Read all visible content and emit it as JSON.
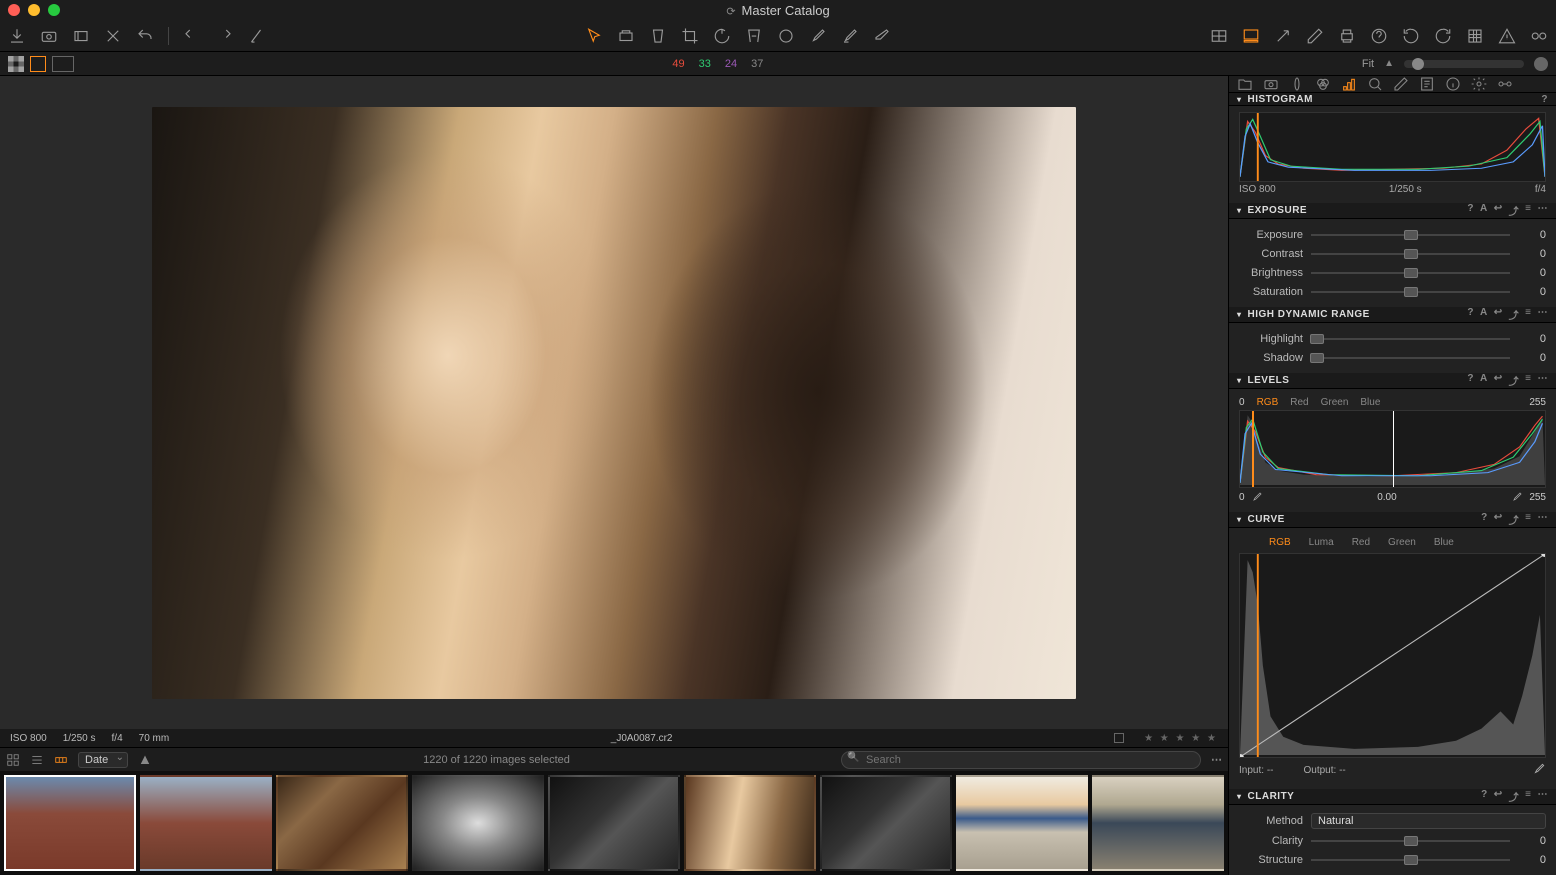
{
  "window": {
    "title": "Master Catalog"
  },
  "counts": {
    "red": "49",
    "green": "33",
    "purple": "24",
    "gray": "37"
  },
  "viewer": {
    "fit_label": "Fit",
    "iso": "ISO 800",
    "shutter": "1/250 s",
    "aperture": "f/4",
    "focal": "70 mm",
    "filename": "_J0A0087.cr2"
  },
  "browser": {
    "sort": "Date",
    "selection": "1220 of 1220 images selected",
    "search_placeholder": "Search"
  },
  "panels": {
    "histogram": {
      "title": "HISTOGRAM",
      "iso": "ISO 800",
      "shutter": "1/250 s",
      "aperture": "f/4"
    },
    "exposure": {
      "title": "EXPOSURE",
      "rows": [
        {
          "label": "Exposure",
          "value": "0",
          "pos": 50
        },
        {
          "label": "Contrast",
          "value": "0",
          "pos": 50
        },
        {
          "label": "Brightness",
          "value": "0",
          "pos": 50
        },
        {
          "label": "Saturation",
          "value": "0",
          "pos": 50
        }
      ]
    },
    "hdr": {
      "title": "HIGH DYNAMIC RANGE",
      "rows": [
        {
          "label": "Highlight",
          "value": "0",
          "pos": 3
        },
        {
          "label": "Shadow",
          "value": "0",
          "pos": 3
        }
      ]
    },
    "levels": {
      "title": "LEVELS",
      "min": "0",
      "max": "255",
      "channels": [
        "RGB",
        "Red",
        "Green",
        "Blue"
      ],
      "black": "0",
      "mid": "0.00",
      "white": "255"
    },
    "curve": {
      "title": "CURVE",
      "tabs": [
        "RGB",
        "Luma",
        "Red",
        "Green",
        "Blue"
      ],
      "input_label": "Input:",
      "input_value": "--",
      "output_label": "Output:",
      "output_value": "--"
    },
    "clarity": {
      "title": "CLARITY",
      "method_label": "Method",
      "method_value": "Natural",
      "rows": [
        {
          "label": "Clarity",
          "value": "0",
          "pos": 50
        },
        {
          "label": "Structure",
          "value": "0",
          "pos": 50
        }
      ]
    }
  }
}
